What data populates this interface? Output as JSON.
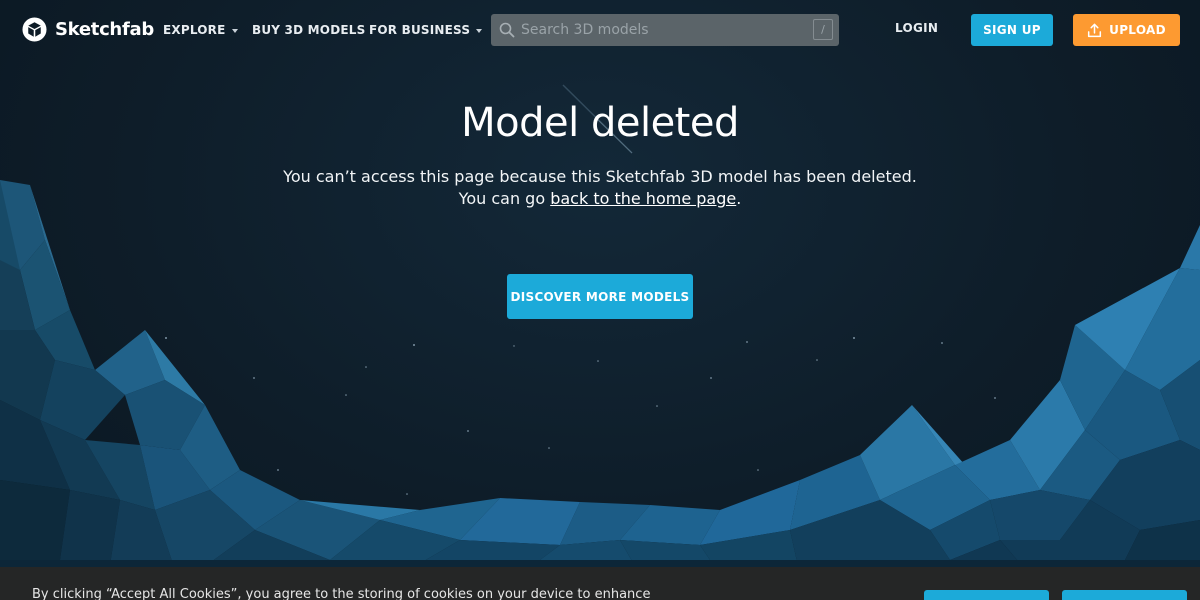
{
  "brand": {
    "name": "Sketchfab"
  },
  "nav": {
    "explore": "EXPLORE",
    "buy": "BUY 3D MODELS",
    "business": "FOR BUSINESS"
  },
  "search": {
    "placeholder": "Search 3D models",
    "shortcut": "/"
  },
  "auth": {
    "login": "LOGIN",
    "signup": "SIGN UP",
    "upload": "UPLOAD"
  },
  "main": {
    "title": "Model deleted",
    "message": "You can’t access this page because this Sketchfab 3D model has been deleted.",
    "go_prefix": "You can go ",
    "home_link": "back to the home page",
    "go_suffix": ".",
    "discover": "DISCOVER MORE MODELS"
  },
  "cookie": {
    "text": "By clicking “Accept All Cookies”, you agree to the storing of cookies on your device to enhance"
  },
  "colors": {
    "accent_blue": "#1caad9",
    "upload_orange": "#fd9a31",
    "background": "#0d1b26"
  }
}
